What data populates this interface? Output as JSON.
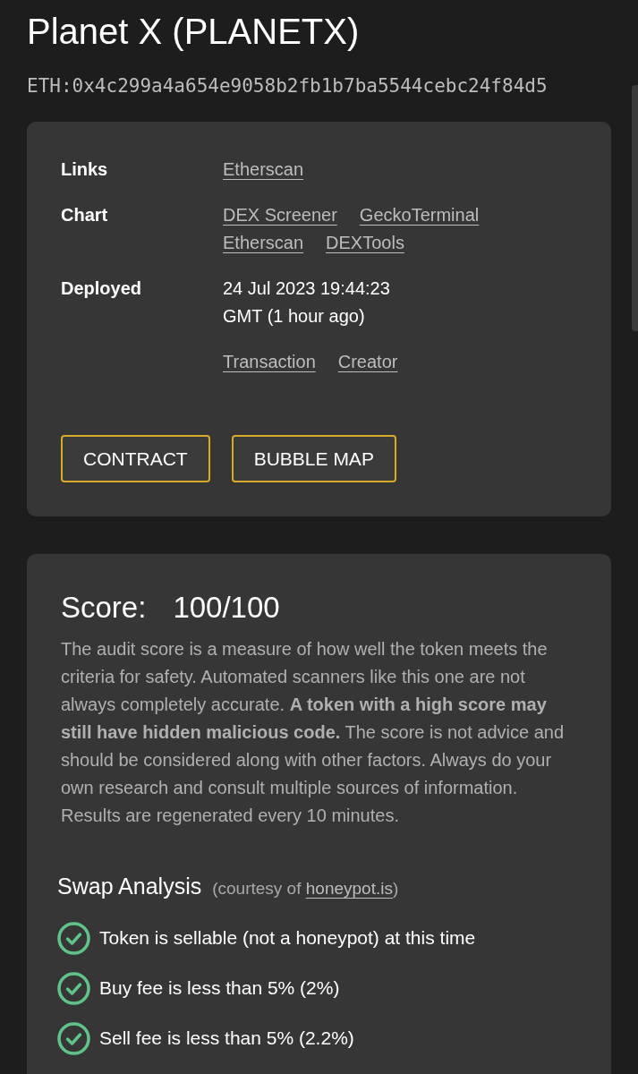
{
  "token": {
    "title": "Planet X (PLANETX)",
    "address": "ETH:0x4c299a4a654e9058b2fb1b7ba5544cebc24f84d5"
  },
  "info_card": {
    "rows": [
      {
        "kind": "links",
        "label": "Links",
        "links": [
          "Etherscan"
        ]
      },
      {
        "kind": "links",
        "label": "Chart",
        "links": [
          "DEX Screener",
          "GeckoTerminal",
          "Etherscan",
          "DEXTools"
        ]
      },
      {
        "kind": "date",
        "label": "Deployed",
        "value": "24 Jul 2023 19:44:23 GMT (1 hour ago)",
        "links": [
          "Transaction",
          "Creator"
        ]
      }
    ],
    "buttons": [
      "CONTRACT",
      "BUBBLE MAP"
    ]
  },
  "score_card": {
    "label": "Score:",
    "value": "100/100",
    "description": "The audit score is a measure of how well the token meets the criteria for safety. Automated scanners like this one are not always completely accurate. **A token with a high score may still have hidden malicious code.** The score is not advice and should be considered along with other factors. Always do your own research and consult multiple sources of information. Results are regenerated every 10 minutes.",
    "swap_analysis": {
      "title": "Swap Analysis",
      "credit_before": "(courtesy of",
      "credit_link": "honeypot.is",
      "credit_after": ")",
      "checks": [
        {
          "text": "Token is sellable (not a honeypot) at this time",
          "passed": true
        },
        {
          "text": "Buy fee is less than 5% (2%)",
          "passed": true
        },
        {
          "text": "Sell fee is less than 5% (2.2%)",
          "passed": true
        }
      ]
    }
  }
}
